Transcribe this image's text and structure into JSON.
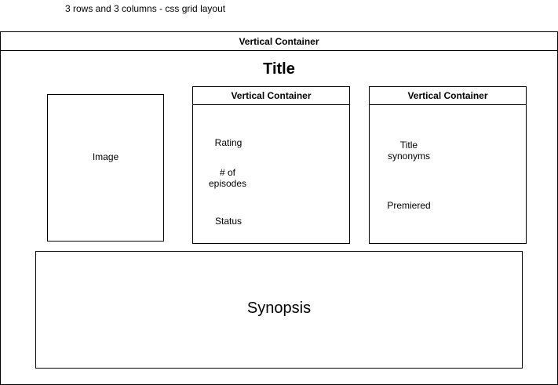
{
  "caption": "3 rows and 3 columns - css grid layout",
  "outer_container": {
    "header": "Vertical Container"
  },
  "title": "Title",
  "image_box": {
    "label": "Image"
  },
  "middle_container": {
    "header": "Vertical Container",
    "labels": [
      "Rating",
      "# of\nepisodes",
      "Status"
    ]
  },
  "right_container": {
    "header": "Vertical Container",
    "labels": [
      "Title\nsynonyms",
      "Premiered"
    ]
  },
  "synopsis": {
    "label": "Synopsis"
  }
}
